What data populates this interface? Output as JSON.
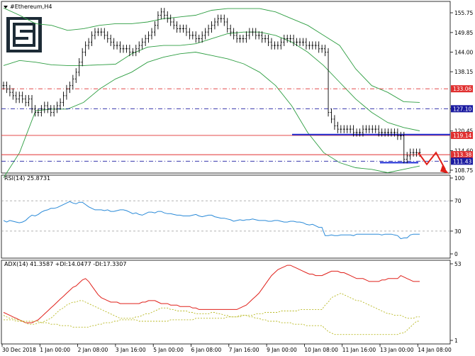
{
  "window": {
    "title": "#Ethereum,H4"
  },
  "logo": {
    "icon": "brand-logo-icon",
    "color": "#1d2b36"
  },
  "main": {
    "price_levels": [
      "155.75",
      "149.85",
      "144.00",
      "138.15",
      "127.10",
      "120.45",
      "114.60",
      "108.75"
    ],
    "hlines": [
      {
        "label": "133.06",
        "value": 133.06,
        "color": "#e03030",
        "style": "dashdot"
      },
      {
        "label": "127.10",
        "value": 127.1,
        "color": "#1a1aa0",
        "style": "dashdot"
      },
      {
        "label": "119.14",
        "value": 119.14,
        "color": "#e03030",
        "style": "solid"
      },
      {
        "label": "113.38",
        "value": 113.38,
        "color": "#e03030",
        "style": "solid"
      },
      {
        "label": "111.43",
        "value": 111.43,
        "color": "#1a1aa0",
        "style": "dashdot"
      }
    ],
    "support_lines": [
      {
        "value": 119.4,
        "color": "#1f2fd6"
      },
      {
        "value": 111.0,
        "color": "#1f2fd6"
      }
    ]
  },
  "rsi": {
    "label": "RSI(14) 25.8731",
    "levels": [
      "100",
      "70",
      "30",
      "0"
    ]
  },
  "adx": {
    "label": "ADX(14) 41.3587 +DI:14.0477 -DI:17.3307",
    "levels": [
      "53",
      "1"
    ]
  },
  "time_labels": [
    "30 Dec 2018",
    "1 Jan 00:00",
    "2 Jan 08:00",
    "3 Jan 16:00",
    "5 Jan 00:00",
    "6 Jan 08:00",
    "7 Jan 16:00",
    "9 Jan 00:00",
    "10 Jan 08:00",
    "11 Jan 16:00",
    "13 Jan 00:00",
    "14 Jan 08:00"
  ],
  "colors": {
    "candle": "#000000",
    "bands": "#2e9e42",
    "rsi": "#2a8ad8",
    "adx": "#e0201a",
    "di": "#b8b820",
    "forecast": "#e0201a"
  },
  "chart_data": {
    "type": "line",
    "title": "#Ethereum,H4",
    "y_range": [
      106.5,
      159.5
    ],
    "close": [
      134,
      133,
      132,
      131,
      130,
      131,
      130,
      129,
      130,
      127,
      126,
      126,
      127,
      128,
      127,
      126,
      127,
      128,
      129,
      131,
      133,
      134,
      136,
      138,
      141,
      144,
      146,
      147,
      149,
      150,
      150,
      150,
      149,
      148,
      147,
      146,
      146,
      145,
      145,
      145,
      144,
      144,
      145,
      146,
      147,
      148,
      149,
      150,
      152,
      155,
      156,
      155,
      154,
      153,
      152,
      151,
      151,
      151,
      150,
      149,
      149,
      148,
      148,
      149,
      150,
      151,
      152,
      153,
      154,
      154,
      153,
      151,
      150,
      149,
      148,
      148,
      148,
      149,
      150,
      150,
      149,
      149,
      148,
      148,
      147,
      146,
      146,
      146,
      147,
      148,
      148,
      148,
      147,
      147,
      147,
      147,
      146,
      146,
      146,
      146,
      145,
      145,
      144,
      126,
      124,
      122,
      121,
      121,
      121,
      121,
      121,
      120,
      120,
      120,
      121,
      121,
      121,
      121,
      121,
      120,
      120,
      120,
      120,
      120,
      120,
      119,
      119,
      112,
      113,
      114,
      114,
      114,
      114
    ],
    "forecast": [
      114.0,
      110.5,
      114.0,
      109.0
    ],
    "bollinger_upper_y": [
      157.2,
      155.0,
      152.5,
      152.0,
      150.5,
      151.0,
      152.0,
      152.5,
      152.5,
      153.0,
      154.0,
      154.5,
      155.0,
      156.5,
      157.0,
      157.0,
      157.0,
      156.0,
      154.0,
      152.0,
      149.0,
      146.0,
      139.0,
      134.0,
      132.0,
      129.2,
      129.0
    ],
    "bollinger_middle_y": [
      140.0,
      141.5,
      141.0,
      140.2,
      140.0,
      140.0,
      140.2,
      140.4,
      143.5,
      145.5,
      146.0,
      146.0,
      146.5,
      148.0,
      149.5,
      150.0,
      150.0,
      149.0,
      147.0,
      144.0,
      140.0,
      135.0,
      130.0,
      126.0,
      123.0,
      121.5,
      120.5
    ],
    "bollinger_lower_y": [
      106.5,
      114.0,
      126.5,
      127.0,
      127.0,
      129.0,
      133.0,
      136.0,
      138.0,
      141.0,
      142.5,
      143.5,
      144.0,
      143.0,
      142.0,
      140.5,
      138.0,
      134.0,
      128.0,
      120.0,
      114.0,
      111.0,
      109.5,
      109.0,
      108.0,
      109.0,
      110.0
    ],
    "rsi": [
      44,
      42,
      44,
      43,
      42,
      41,
      42,
      44,
      48,
      51,
      50,
      52,
      55,
      57,
      58,
      60,
      60,
      61,
      63,
      65,
      67,
      69,
      67,
      66,
      68,
      68,
      65,
      62,
      60,
      58,
      58,
      58,
      57,
      58,
      56,
      56,
      57,
      58,
      58,
      57,
      55,
      53,
      54,
      52,
      51,
      53,
      55,
      55,
      54,
      56,
      56,
      54,
      53,
      53,
      52,
      51,
      51,
      50,
      50,
      50,
      51,
      52,
      50,
      49,
      50,
      51,
      51,
      49,
      48,
      47,
      47,
      46,
      45,
      43,
      44,
      45,
      44,
      45,
      45,
      46,
      45,
      44,
      44,
      44,
      43,
      43,
      44,
      44,
      43,
      42,
      42,
      43,
      43,
      42,
      42,
      41,
      39,
      38,
      39,
      37,
      35,
      35,
      24,
      24,
      25,
      24,
      24,
      25,
      25,
      25,
      25,
      24,
      26,
      26,
      26,
      26,
      26,
      26,
      26,
      26,
      25,
      26,
      26,
      26,
      25,
      24,
      20,
      21,
      21,
      25,
      26,
      26,
      26
    ],
    "adx": [
      20,
      19,
      18,
      17,
      16,
      15,
      14,
      13,
      13,
      13,
      14,
      15,
      17,
      19,
      21,
      23,
      25,
      27,
      29,
      31,
      33,
      35,
      37,
      38,
      40,
      42,
      43,
      41,
      38,
      35,
      32,
      30,
      29,
      28,
      27,
      27,
      27,
      26,
      26,
      26,
      26,
      26,
      26,
      26,
      27,
      27,
      28,
      28,
      28,
      27,
      26,
      26,
      26,
      25,
      25,
      25,
      24,
      24,
      24,
      24,
      23,
      23,
      22,
      22,
      22,
      22,
      22,
      22,
      22,
      22,
      22,
      22,
      22,
      22,
      22,
      23,
      24,
      25,
      27,
      29,
      31,
      33,
      36,
      39,
      42,
      45,
      47,
      49,
      50,
      51,
      52,
      52,
      51,
      50,
      49,
      48,
      47,
      46,
      46,
      45,
      45,
      45,
      46,
      47,
      48,
      48,
      48,
      47,
      47,
      46,
      45,
      44,
      43,
      43,
      43,
      42,
      41,
      41,
      41,
      41,
      42,
      42,
      43,
      43,
      43,
      43,
      45,
      44,
      43,
      42,
      41,
      41,
      41
    ],
    "plus_di": [
      18,
      17,
      16,
      16,
      15,
      15,
      14,
      13,
      12,
      12,
      12,
      13,
      13,
      14,
      15,
      16,
      18,
      20,
      22,
      23,
      25,
      26,
      27,
      27,
      28,
      28,
      27,
      26,
      25,
      24,
      23,
      22,
      21,
      20,
      19,
      18,
      17,
      16,
      16,
      16,
      16,
      16,
      17,
      17,
      18,
      19,
      19,
      20,
      21,
      22,
      23,
      23,
      23,
      22,
      22,
      21,
      21,
      21,
      21,
      20,
      20,
      19,
      19,
      19,
      19,
      19,
      20,
      20,
      19,
      19,
      18,
      18,
      17,
      17,
      17,
      18,
      18,
      18,
      17,
      17,
      16,
      16,
      15,
      15,
      14,
      14,
      14,
      14,
      13,
      13,
      13,
      13,
      12,
      12,
      12,
      12,
      11,
      11,
      11,
      11,
      11,
      11,
      9,
      7,
      6,
      5,
      5,
      5,
      5,
      5,
      5,
      5,
      5,
      5,
      5,
      5,
      5,
      5,
      5,
      5,
      5,
      5,
      5,
      5,
      5,
      5,
      6,
      6,
      8,
      10,
      12,
      14,
      14
    ],
    "minus_di": [
      15,
      15,
      15,
      15,
      14,
      14,
      14,
      14,
      14,
      14,
      14,
      14,
      13,
      13,
      13,
      12,
      12,
      12,
      11,
      11,
      11,
      11,
      10,
      10,
      10,
      10,
      10,
      10,
      11,
      11,
      12,
      12,
      13,
      13,
      13,
      14,
      14,
      15,
      15,
      15,
      15,
      15,
      15,
      14,
      14,
      14,
      14,
      14,
      14,
      14,
      14,
      14,
      14,
      15,
      15,
      15,
      15,
      15,
      15,
      15,
      15,
      16,
      16,
      16,
      16,
      16,
      16,
      16,
      16,
      16,
      16,
      17,
      17,
      17,
      17,
      17,
      18,
      18,
      18,
      18,
      19,
      19,
      19,
      20,
      20,
      20,
      20,
      20,
      21,
      21,
      21,
      21,
      21,
      21,
      22,
      22,
      22,
      22,
      22,
      22,
      22,
      22,
      25,
      27,
      30,
      31,
      32,
      33,
      32,
      31,
      30,
      29,
      28,
      28,
      27,
      26,
      25,
      24,
      23,
      22,
      21,
      20,
      19,
      19,
      18,
      18,
      18,
      17,
      16,
      16,
      16,
      17,
      17
    ]
  }
}
